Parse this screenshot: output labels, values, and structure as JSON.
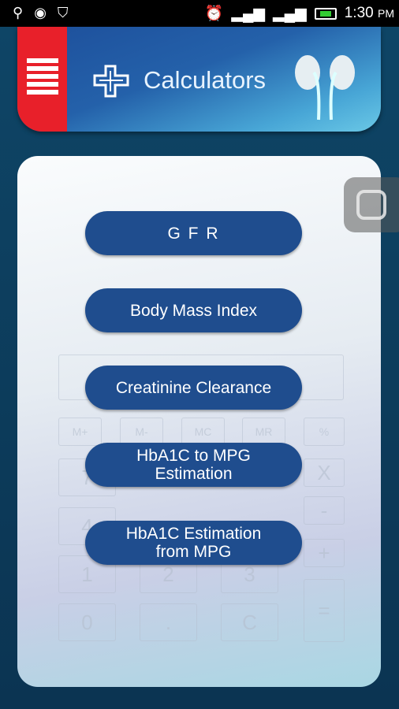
{
  "status_bar": {
    "time": "1:30",
    "ampm": "PM",
    "icons": [
      "usb-icon",
      "app-icon",
      "shield-icon",
      "alarm-icon",
      "signal-icon",
      "signal-icon",
      "battery-charging-icon"
    ]
  },
  "header": {
    "title": "Calculators",
    "menu_icon": "hamburger-menu-icon",
    "logo_icon": "medical-cross-icon",
    "decor_icon": "kidneys-icon",
    "colors": {
      "menu": "#e8202a",
      "banner": "#2461aa"
    }
  },
  "menu": {
    "buttons": [
      {
        "label": "G F R"
      },
      {
        "label": "Body Mass Index"
      },
      {
        "label": "Creatinine Clearance"
      },
      {
        "label": "HbA1C to MPG\nEstimation"
      },
      {
        "label": "HbA1C Estimation\nfrom MPG"
      }
    ],
    "button_color": "#1f4d8e"
  },
  "background_keys": [
    "M+",
    "M-",
    "MC",
    "MR",
    "%",
    "7",
    "X",
    "4",
    "-",
    "+",
    "1",
    "2",
    "3",
    "=",
    "0",
    ".",
    "C"
  ]
}
